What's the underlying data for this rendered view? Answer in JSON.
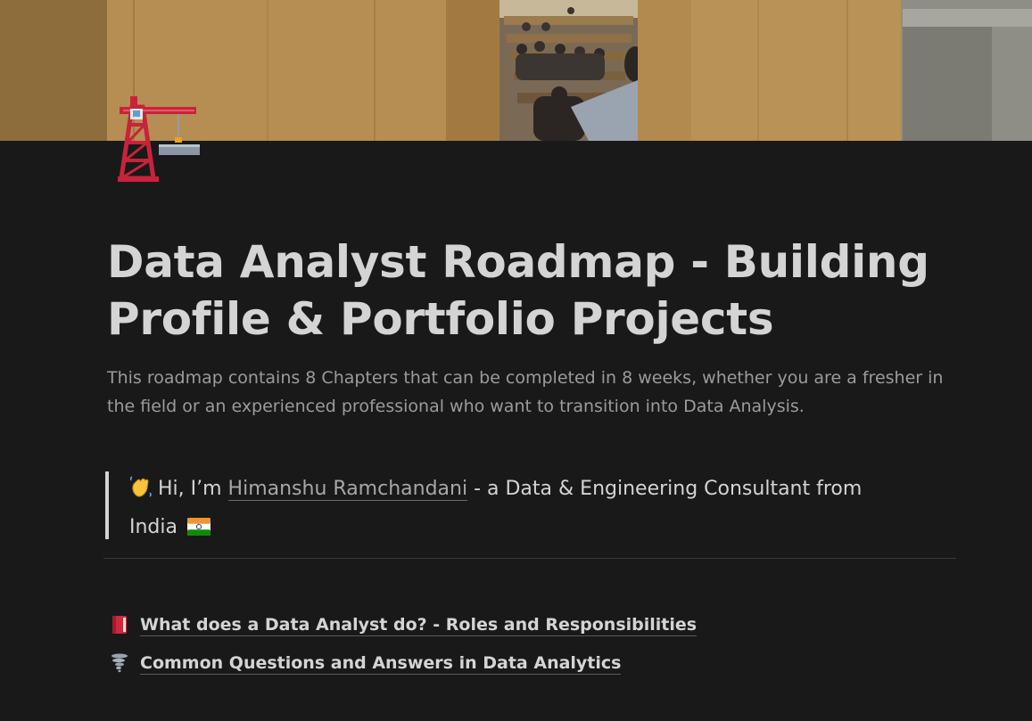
{
  "page": {
    "title": "Data Analyst Roadmap - Building Profile & Portfolio Projects",
    "subtitle": "This roadmap contains 8 Chapters that can be completed in 8 weeks, whether you are a fresher in the field or an experienced professional who want to transition into Data Analysis.",
    "cover_image": "painting-of-lecture-hall-cover",
    "page_icon": "construction-crane-icon"
  },
  "callout": {
    "icon": "waving-hand-icon",
    "prefix": "Hi, I’m ",
    "link_text": "Himanshu Ramchandani",
    "suffix_line1": " - a Data & Engineering Consultant from",
    "suffix_line2": "India ",
    "flag": "india-flag-icon"
  },
  "links": [
    {
      "icon": "red-book-icon",
      "label": "What does a Data Analyst do? - Roles and Responsibilities"
    },
    {
      "icon": "tornado-icon",
      "label": "Common Questions and Answers in Data Analytics"
    }
  ],
  "colors": {
    "background": "#191919",
    "text": "#d4d4d4",
    "muted": "#9b9b9b",
    "divider": "#3a3a3a"
  }
}
